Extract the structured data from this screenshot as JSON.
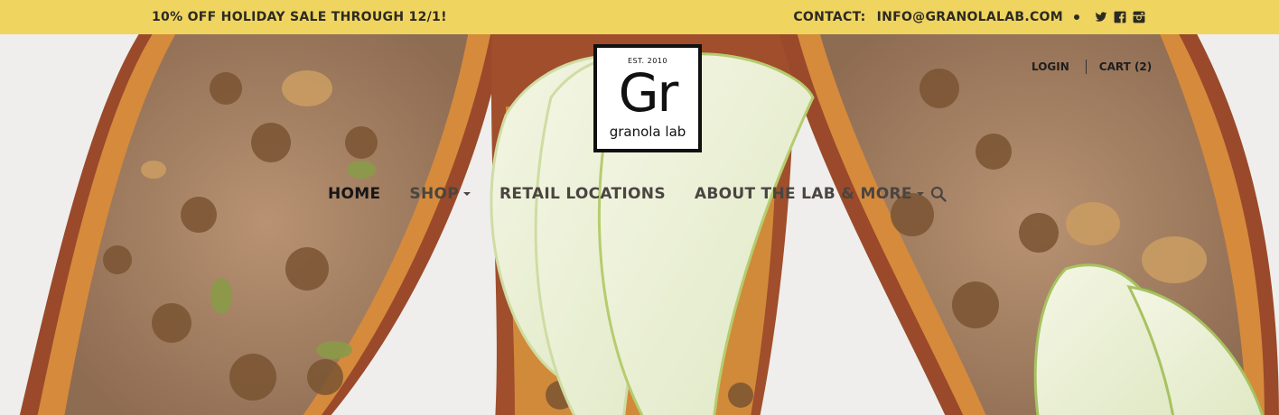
{
  "announcement": {
    "promo": "10% OFF HOLIDAY SALE THROUGH 12/1!",
    "contact_label": "CONTACT:",
    "email": "INFO@GRANOLALAB.COM",
    "social_icons": [
      "twitter-icon",
      "facebook-icon",
      "instagram-icon"
    ],
    "bar_color": "#efd460"
  },
  "logo": {
    "est": "EST. 2010",
    "mark": "Gr",
    "name": "granola lab"
  },
  "account": {
    "login": "LOGIN",
    "cart": "CART (2)"
  },
  "nav": {
    "items": [
      {
        "label": "HOME",
        "active": true
      },
      {
        "label": "SHOP",
        "dropdown": true
      },
      {
        "label": "RETAIL LOCATIONS"
      },
      {
        "label": "ABOUT THE LAB & MORE",
        "dropdown": true
      }
    ],
    "search_icon": "search-icon"
  }
}
